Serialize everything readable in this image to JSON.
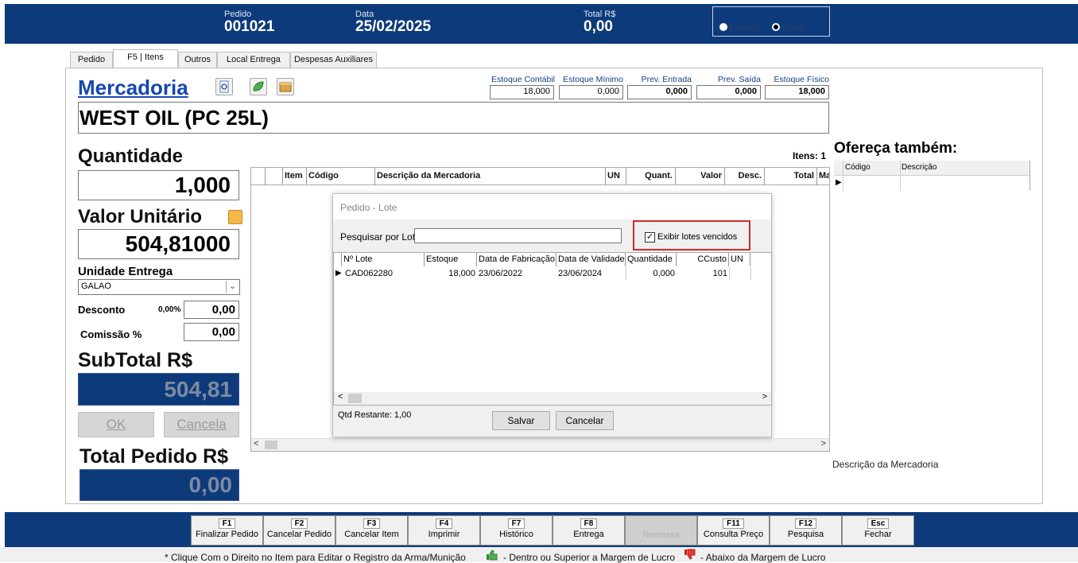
{
  "header": {
    "pedido_label": "Pedido",
    "pedido_value": "001021",
    "data_label": "Data",
    "data_value": "25/02/2025",
    "total_label": "Total R$",
    "total_value": "0,00",
    "entrada_label": "Entrada",
    "saida_label": "Saída"
  },
  "tabs": [
    "Pedido",
    "F5 | Itens",
    "Outros",
    "Local Entrega",
    "Despesas Auxiliares"
  ],
  "mercadoria": {
    "label": "Mercadoria",
    "name": "WEST OIL (PC 25L)"
  },
  "stock": {
    "contabil_label": "Estoque Contábil",
    "contabil_value": "18,000",
    "minimo_label": "Estoque Mínimo",
    "minimo_value": "0,000",
    "prev_entrada_label": "Prev. Entrada",
    "prev_entrada_value": "0,000",
    "prev_saida_label": "Prev. Saída",
    "prev_saida_value": "0,000",
    "fisico_label": "Estoque Físico",
    "fisico_value": "18,000"
  },
  "form": {
    "quantidade_label": "Quantidade",
    "quantidade_value": "1,000",
    "valor_unitario_label": "Valor Unitário",
    "valor_unitario_value": "504,81000",
    "unidade_label": "Unidade Entrega",
    "unidade_value": "GALAO",
    "desconto_label": "Desconto",
    "desconto_pct": "0,00%",
    "desconto_value": "0,00",
    "comissao_label": "Comissão %",
    "comissao_value": "0,00",
    "subtotal_label": "SubTotal R$",
    "subtotal_value": "504,81",
    "ok_label": "OK",
    "cancela_label": "Cancela",
    "total_pedido_label": "Total Pedido R$",
    "total_pedido_value": "0,00"
  },
  "items_grid": {
    "count_label": "Itens: 1",
    "columns": [
      "Item",
      "Código",
      "Descrição da Mercadoria",
      "UN",
      "Quant.",
      "Valor",
      "Desc.",
      "Total",
      "Ma"
    ]
  },
  "ofereca": {
    "title": "Ofereça também:",
    "columns": [
      "Código",
      "Descrição"
    ],
    "desc_label": "Descrição da Mercadoria"
  },
  "dialog": {
    "title": "Pedido - Lote",
    "search_label": "Pesquisar por Lote",
    "search_value": "",
    "checkbox_label": "Exibir lotes vencidos",
    "columns": [
      "Nº Lote",
      "Estoque",
      "Data de Fabricação",
      "Data de Validade",
      "Quantidade",
      "CCusto",
      "UN"
    ],
    "rows": [
      {
        "lote": "CAD062280",
        "estoque": "18,000",
        "fabricacao": "23/06/2022",
        "validade": "23/06/2024",
        "quantidade": "0,000",
        "ccusto": "101",
        "un": ""
      }
    ],
    "qtd_restante": "Qtd Restante: 1,00",
    "save_label": "Salvar",
    "cancel_label": "Cancelar"
  },
  "footer": [
    {
      "key": "F1",
      "label": "Finalizar Pedido"
    },
    {
      "key": "F2",
      "label": "Cancelar Pedido"
    },
    {
      "key": "F3",
      "label": "Cancelar Item"
    },
    {
      "key": "F4",
      "label": "Imprimir"
    },
    {
      "key": "F7",
      "label": "Histórico"
    },
    {
      "key": "F8",
      "label": "Entrega"
    },
    {
      "key": "",
      "label": "Remessa"
    },
    {
      "key": "F11",
      "label": "Consulta Preço"
    },
    {
      "key": "F12",
      "label": "Pesquisa"
    },
    {
      "key": "Esc",
      "label": "Fechar"
    }
  ],
  "status": {
    "note": "* Clique Com o Direito no Item para Editar o Registro da Arma/Munição",
    "good": "- Dentro ou Superior a Margem de Lucro",
    "bad": "- Abaixo da Margem de Lucro"
  }
}
